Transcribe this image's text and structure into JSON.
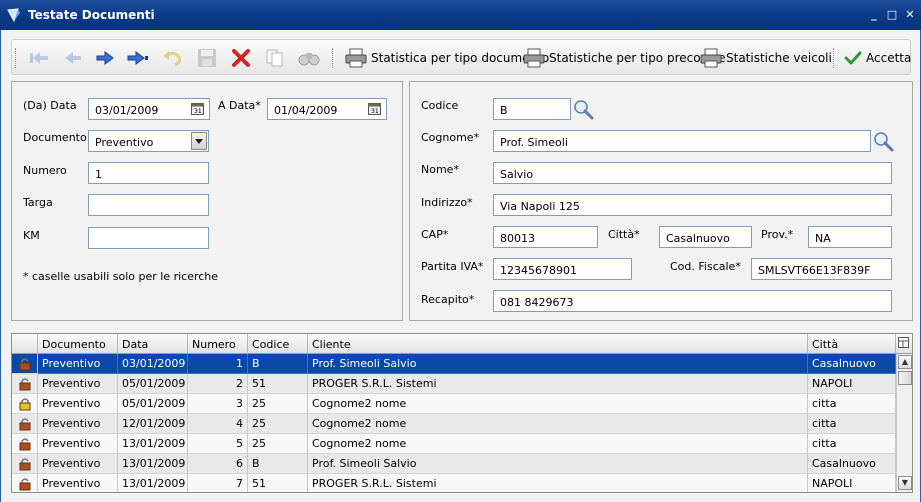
{
  "window": {
    "title": "Testate Documenti",
    "minimize": "_",
    "maximize": "□",
    "close": "✕"
  },
  "toolbar": {
    "buttons": [
      "first-record-icon",
      "previous-record-icon",
      "next-record-icon",
      "last-record-icon",
      "undo-icon",
      "save-icon",
      "delete-icon",
      "copy-icon",
      "find-icon"
    ],
    "stat_doc_label": "Statistica per tipo documento",
    "stat_precodice_label": "Statistiche per tipo precodice",
    "stat_veicoli_label": "Statistiche veicoli",
    "accept_label": "Accetta"
  },
  "search_form": {
    "da_data_label": "(Da) Data",
    "da_data_value": "03/01/2009",
    "a_data_label": "A Data*",
    "a_data_value": "01/04/2009",
    "documento_label": "Documento",
    "documento_value": "Preventivo",
    "numero_label": "Numero",
    "numero_value": "1",
    "targa_label": "Targa",
    "targa_value": "",
    "km_label": "KM",
    "km_value": "",
    "note": "* caselle usabili solo per le ricerche"
  },
  "customer_form": {
    "codice_label": "Codice",
    "codice_value": "B",
    "cognome_label": "Cognome*",
    "cognome_value": "Prof. Simeoli",
    "nome_label": "Nome*",
    "nome_value": "Salvio",
    "indirizzo_label": "Indirizzo*",
    "indirizzo_value": "Via Napoli 125",
    "cap_label": "CAP*",
    "cap_value": "80013",
    "citta_label": "Città*",
    "citta_value": "Casalnuovo",
    "prov_label": "Prov.*",
    "prov_value": "NA",
    "piva_label": "Partita IVA*",
    "piva_value": "12345678901",
    "codfisc_label": "Cod. Fiscale*",
    "codfisc_value": "SMLSVT66E13F839F",
    "recapito_label": "Recapito*",
    "recapito_value": "081 8429673"
  },
  "grid": {
    "columns": [
      "Documento",
      "Data",
      "Numero",
      "Codice",
      "Cliente",
      "Città"
    ],
    "rows": [
      {
        "lock": "open",
        "documento": "Preventivo",
        "data": "03/01/2009",
        "numero": "1",
        "codice": "B",
        "cliente": "Prof. Simeoli Salvio",
        "citta": "Casalnuovo",
        "selected": true
      },
      {
        "lock": "open",
        "documento": "Preventivo",
        "data": "05/01/2009",
        "numero": "2",
        "codice": "51",
        "cliente": "PROGER S.R.L. Sistemi",
        "citta": "NAPOLI"
      },
      {
        "lock": "closed",
        "documento": "Preventivo",
        "data": "05/01/2009",
        "numero": "3",
        "codice": "25",
        "cliente": "Cognome2 nome",
        "citta": "citta"
      },
      {
        "lock": "open",
        "documento": "Preventivo",
        "data": "12/01/2009",
        "numero": "4",
        "codice": "25",
        "cliente": "Cognome2 nome",
        "citta": "citta"
      },
      {
        "lock": "open",
        "documento": "Preventivo",
        "data": "13/01/2009",
        "numero": "5",
        "codice": "25",
        "cliente": "Cognome2 nome",
        "citta": "citta"
      },
      {
        "lock": "open",
        "documento": "Preventivo",
        "data": "13/01/2009",
        "numero": "6",
        "codice": "B",
        "cliente": "Prof. Simeoli Salvio",
        "citta": "Casalnuovo"
      },
      {
        "lock": "open",
        "documento": "Preventivo",
        "data": "13/01/2009",
        "numero": "7",
        "codice": "51",
        "cliente": "PROGER S.R.L. Sistemi",
        "citta": "NAPOLI"
      }
    ]
  },
  "colors": {
    "selection": "#0a49a8",
    "title_bar": "#0b3a8a",
    "delete_red": "#d8231f",
    "nav_blue": "#3a6fd1"
  }
}
